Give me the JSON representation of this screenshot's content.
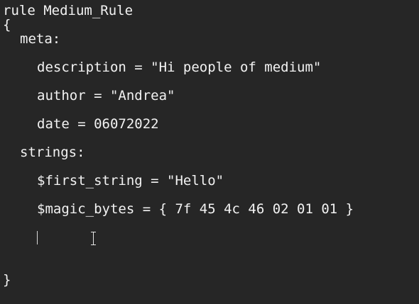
{
  "editor": {
    "lines": {
      "rule_header": "rule Medium_Rule",
      "open_brace": "{",
      "meta_label": "meta:",
      "description": "description = \"Hi people of medium\"",
      "author": "author = \"Andrea\"",
      "date": "date = 06072022",
      "strings_label": "strings:",
      "first_string": "$first_string = \"Hello\"",
      "magic_bytes": "$magic_bytes = { 7f 45 4c 46 02 01 01 }",
      "close_brace": "}"
    }
  },
  "colors": {
    "background": "#262626",
    "text": "#f2f2f2"
  },
  "icons": {
    "mouse_pointer": "text-cursor-ibeam-icon"
  }
}
